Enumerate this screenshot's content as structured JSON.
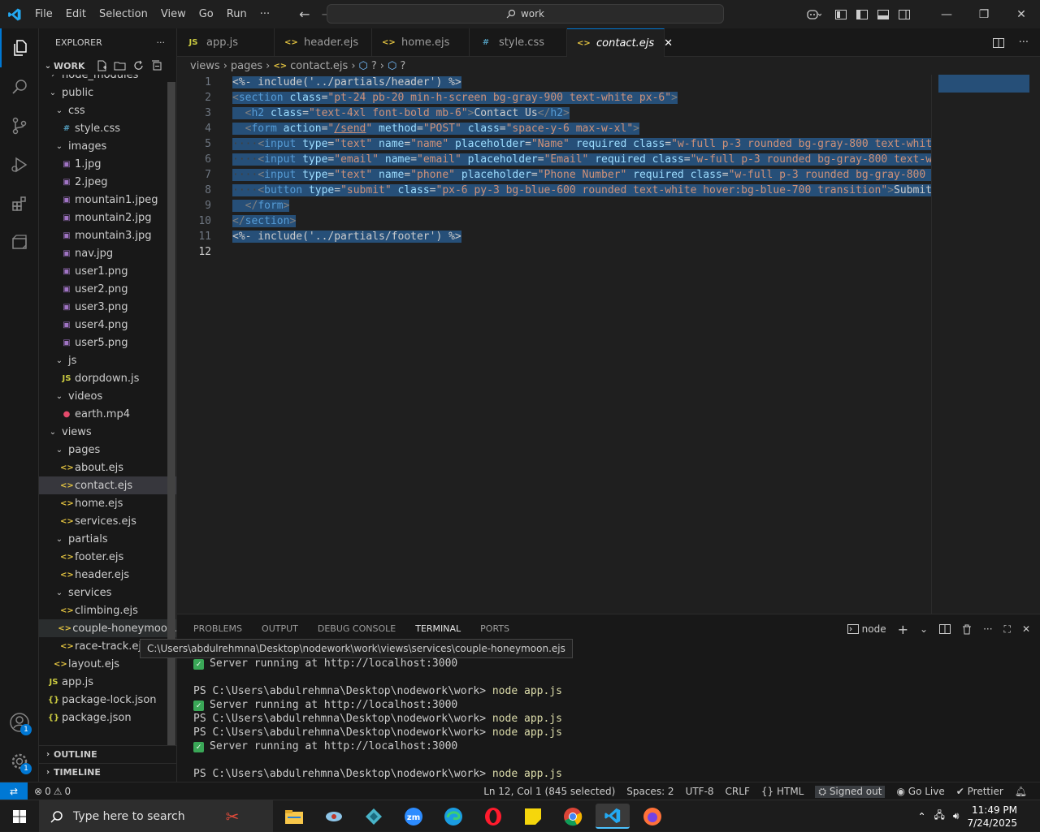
{
  "titlebar": {
    "menu": [
      "File",
      "Edit",
      "Selection",
      "View",
      "Go",
      "Run",
      "···"
    ],
    "search": "work"
  },
  "explorer": {
    "header": "EXPLORER",
    "root": "WORK",
    "items": [
      {
        "label": "node_modules",
        "indent": 1,
        "kind": "folder-closed"
      },
      {
        "label": "public",
        "indent": 1,
        "kind": "folder-open"
      },
      {
        "label": "css",
        "indent": 2,
        "kind": "folder-open"
      },
      {
        "label": "style.css",
        "indent": 3,
        "kind": "css"
      },
      {
        "label": "images",
        "indent": 2,
        "kind": "folder-open"
      },
      {
        "label": "1.jpg",
        "indent": 3,
        "kind": "img"
      },
      {
        "label": "2.jpeg",
        "indent": 3,
        "kind": "img"
      },
      {
        "label": "mountain1.jpeg",
        "indent": 3,
        "kind": "img"
      },
      {
        "label": "mountain2.jpg",
        "indent": 3,
        "kind": "img"
      },
      {
        "label": "mountain3.jpg",
        "indent": 3,
        "kind": "img"
      },
      {
        "label": "nav.jpg",
        "indent": 3,
        "kind": "img"
      },
      {
        "label": "user1.png",
        "indent": 3,
        "kind": "img"
      },
      {
        "label": "user2.png",
        "indent": 3,
        "kind": "img"
      },
      {
        "label": "user3.png",
        "indent": 3,
        "kind": "img"
      },
      {
        "label": "user4.png",
        "indent": 3,
        "kind": "img"
      },
      {
        "label": "user5.png",
        "indent": 3,
        "kind": "img"
      },
      {
        "label": "js",
        "indent": 2,
        "kind": "folder-open"
      },
      {
        "label": "dorpdown.js",
        "indent": 3,
        "kind": "js"
      },
      {
        "label": "videos",
        "indent": 2,
        "kind": "folder-open"
      },
      {
        "label": "earth.mp4",
        "indent": 3,
        "kind": "video"
      },
      {
        "label": "views",
        "indent": 1,
        "kind": "folder-open"
      },
      {
        "label": "pages",
        "indent": 2,
        "kind": "folder-open"
      },
      {
        "label": "about.ejs",
        "indent": 3,
        "kind": "ejs"
      },
      {
        "label": "contact.ejs",
        "indent": 3,
        "kind": "ejs",
        "selected": true
      },
      {
        "label": "home.ejs",
        "indent": 3,
        "kind": "ejs"
      },
      {
        "label": "services.ejs",
        "indent": 3,
        "kind": "ejs"
      },
      {
        "label": "partials",
        "indent": 2,
        "kind": "folder-open"
      },
      {
        "label": "footer.ejs",
        "indent": 3,
        "kind": "ejs"
      },
      {
        "label": "header.ejs",
        "indent": 3,
        "kind": "ejs"
      },
      {
        "label": "services",
        "indent": 2,
        "kind": "folder-open"
      },
      {
        "label": "climbing.ejs",
        "indent": 3,
        "kind": "ejs"
      },
      {
        "label": "couple-honeymoo...",
        "indent": 3,
        "kind": "ejs",
        "hover": true
      },
      {
        "label": "race-track.ejs",
        "indent": 3,
        "kind": "ejs"
      },
      {
        "label": "layout.ejs",
        "indent": 2,
        "kind": "ejs"
      },
      {
        "label": "app.js",
        "indent": 1,
        "kind": "js"
      },
      {
        "label": "package-lock.json",
        "indent": 1,
        "kind": "json"
      },
      {
        "label": "package.json",
        "indent": 1,
        "kind": "json"
      }
    ],
    "outline": "OUTLINE",
    "timeline": "TIMELINE"
  },
  "tabs": [
    {
      "label": "app.js",
      "kind": "js"
    },
    {
      "label": "header.ejs",
      "kind": "ejs"
    },
    {
      "label": "home.ejs",
      "kind": "ejs"
    },
    {
      "label": "style.css",
      "kind": "css"
    },
    {
      "label": "contact.ejs",
      "kind": "ejs",
      "active": true
    }
  ],
  "breadcrumb": [
    "views",
    "pages",
    "contact.ejs",
    "?",
    "?"
  ],
  "editor": {
    "line_numbers": [
      "1",
      "2",
      "3",
      "4",
      "5",
      "6",
      "7",
      "8",
      "9",
      "10",
      "11",
      "12"
    ],
    "current_line": "12"
  },
  "tooltip": "C:\\Users\\abdulrehmna\\Desktop\\nodework\\work\\views\\services\\couple-honeymoon.ejs",
  "panel": {
    "tabs": [
      "PROBLEMS",
      "OUTPUT",
      "DEBUG CONSOLE",
      "TERMINAL",
      "PORTS"
    ],
    "active_tab": "TERMINAL",
    "terminal_name": "node",
    "prompt": "PS C:\\Users\\abdulrehmna\\Desktop\\nodework\\work>",
    "command": "node app.js",
    "server_msg": "Server running at http://localhost:3000"
  },
  "status": {
    "errors": "0",
    "warnings": "0",
    "position": "Ln 12, Col 1 (845 selected)",
    "spaces": "Spaces: 2",
    "encoding": "UTF-8",
    "eol": "CRLF",
    "language": "HTML",
    "account": "Signed out",
    "golive": "Go Live",
    "prettier": "Prettier"
  },
  "taskbar": {
    "search_placeholder": "Type here to search",
    "time": "11:49 PM",
    "date": "7/24/2025"
  },
  "colors": {
    "accent": "#0078d4",
    "selection": "#264f78",
    "tag": "#569cd6",
    "attr": "#9cdcfe",
    "string": "#ce9178",
    "command": "#dcdcaa"
  }
}
